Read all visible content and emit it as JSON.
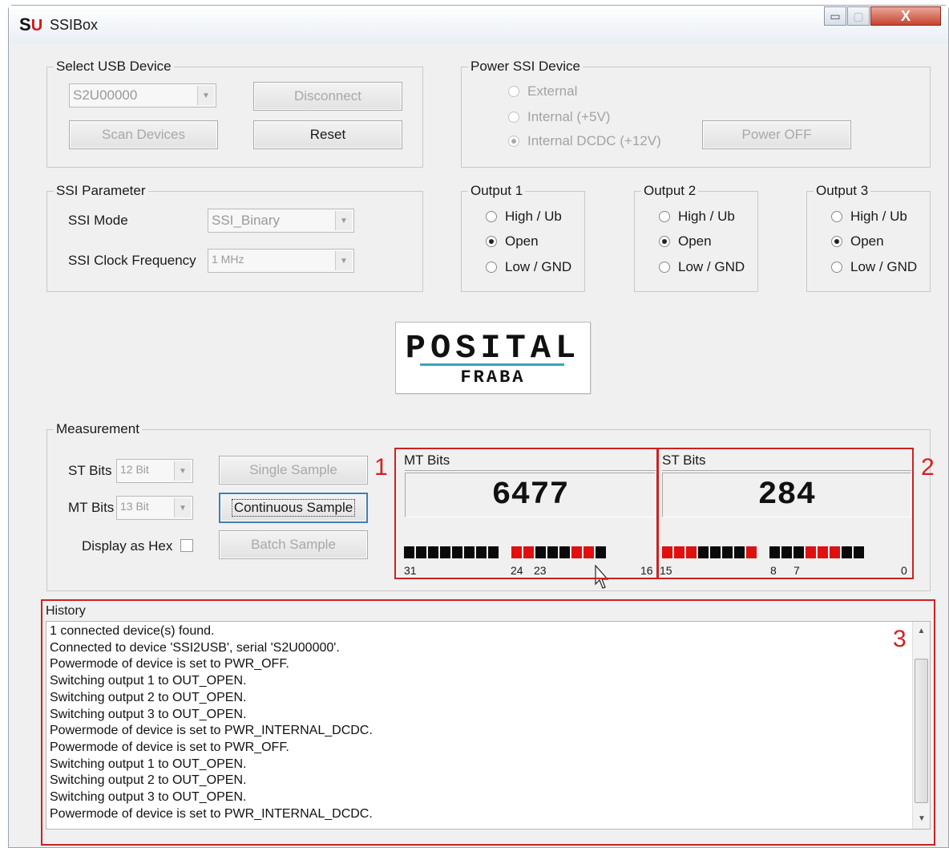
{
  "window": {
    "title": "SSIBox",
    "logo_s": "S",
    "logo_u": "U",
    "minimize": "▭",
    "maximize": "▢",
    "close": "X"
  },
  "usb_device": {
    "group_label": "Select USB Device",
    "device_value": "S2U00000",
    "disconnect": "Disconnect",
    "scan": "Scan Devices",
    "reset": "Reset"
  },
  "power": {
    "group_label": "Power SSI Device",
    "options": [
      "External",
      "Internal (+5V)",
      "Internal DCDC (+12V)"
    ],
    "selected": 2,
    "power_button": "Power OFF"
  },
  "ssi_param": {
    "group_label": "SSI Parameter",
    "mode_label": "SSI Mode",
    "mode_value": "SSI_Binary",
    "freq_label": "SSI Clock Frequency",
    "freq_value": "1 MHz"
  },
  "outputs": [
    {
      "label": "Output 1",
      "options": [
        "High / Ub",
        "Open",
        "Low / GND"
      ],
      "selected": 1
    },
    {
      "label": "Output 2",
      "options": [
        "High / Ub",
        "Open",
        "Low / GND"
      ],
      "selected": 1
    },
    {
      "label": "Output 3",
      "options": [
        "High / Ub",
        "Open",
        "Low / GND"
      ],
      "selected": 1
    }
  ],
  "logo": {
    "top": "POSITAL",
    "bottom": "FRABA"
  },
  "measurement": {
    "group_label": "Measurement",
    "st_bits_label": "ST Bits",
    "st_bits_value": "12 Bit",
    "mt_bits_label": "MT Bits",
    "mt_bits_value": "13 Bit",
    "hex_label": "Display as Hex",
    "hex_checked": false,
    "single": "Single Sample",
    "continuous": "Continuous Sample",
    "batch": "Batch Sample"
  },
  "mt_panel": {
    "title": "MT Bits",
    "value": "6477",
    "bits": [
      0,
      0,
      0,
      0,
      0,
      0,
      0,
      0,
      1,
      1,
      0,
      0,
      0,
      1,
      1,
      0
    ],
    "labels": [
      "31",
      "24",
      "23",
      "16"
    ]
  },
  "st_panel": {
    "title": "ST Bits",
    "value": "284",
    "bits": [
      1,
      1,
      1,
      0,
      0,
      0,
      0,
      1,
      0,
      0,
      0,
      1,
      1,
      1,
      0,
      0
    ],
    "labels": [
      "15",
      "8",
      "7",
      "0"
    ]
  },
  "annotations": {
    "one": "1",
    "two": "2",
    "three": "3"
  },
  "annotation_color": "#cc2222",
  "bit_on_color": "#e01010",
  "bit_off_color": "#0a0a0a",
  "history": {
    "label": "History",
    "lines": [
      "1 connected device(s) found.",
      "Connected to device 'SSI2USB', serial 'S2U00000'.",
      "Powermode of device is set to PWR_OFF.",
      "Switching output 1 to OUT_OPEN.",
      "Switching output 2 to OUT_OPEN.",
      "Switching output 3 to OUT_OPEN.",
      "Powermode of device is set to PWR_INTERNAL_DCDC.",
      "Powermode of device is set to PWR_OFF.",
      "Switching output 1 to OUT_OPEN.",
      "Switching output 2 to OUT_OPEN.",
      "Switching output 3 to OUT_OPEN.",
      "Powermode of device is set to PWR_INTERNAL_DCDC."
    ]
  }
}
